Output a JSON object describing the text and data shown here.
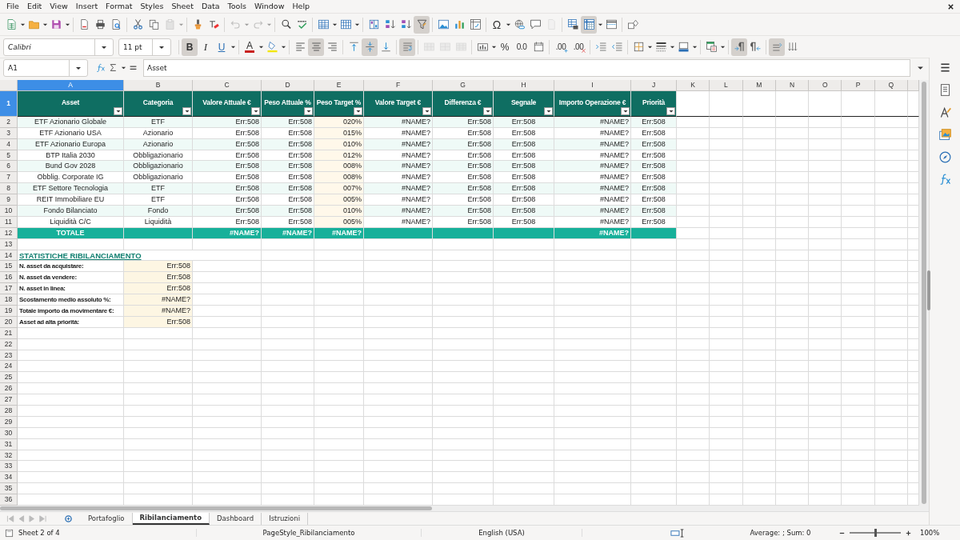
{
  "menu": [
    "File",
    "Edit",
    "View",
    "Insert",
    "Format",
    "Styles",
    "Sheet",
    "Data",
    "Tools",
    "Window",
    "Help"
  ],
  "toolbar_standard": [
    {
      "kind": "new",
      "dropdown": true,
      "pressed": false,
      "disabled": false
    },
    {
      "kind": "open",
      "dropdown": true,
      "pressed": false,
      "disabled": false
    },
    {
      "kind": "save",
      "dropdown": true,
      "pressed": false,
      "disabled": false
    },
    {
      "kind": "separator"
    },
    {
      "kind": "export_pdf",
      "pressed": false,
      "disabled": false
    },
    {
      "kind": "print",
      "pressed": false,
      "disabled": false
    },
    {
      "kind": "print_preview",
      "pressed": false,
      "disabled": false
    },
    {
      "kind": "separator"
    },
    {
      "kind": "cut",
      "pressed": false,
      "disabled": false
    },
    {
      "kind": "copy",
      "pressed": false,
      "disabled": false
    },
    {
      "kind": "paste",
      "dropdown": true,
      "pressed": false,
      "disabled": true
    },
    {
      "kind": "separator"
    },
    {
      "kind": "clone_formatting",
      "pressed": false,
      "disabled": false
    },
    {
      "kind": "clear_formatting",
      "pressed": false,
      "disabled": false
    },
    {
      "kind": "separator"
    },
    {
      "kind": "undo",
      "dropdown": true,
      "pressed": false,
      "disabled": true
    },
    {
      "kind": "redo",
      "dropdown": true,
      "pressed": false,
      "disabled": true
    },
    {
      "kind": "separator"
    },
    {
      "kind": "find_replace",
      "pressed": false,
      "disabled": false
    },
    {
      "kind": "spelling",
      "pressed": false,
      "disabled": false
    },
    {
      "kind": "separator"
    },
    {
      "kind": "rows",
      "dropdown": true,
      "pressed": false,
      "disabled": false
    },
    {
      "kind": "columns",
      "dropdown": true,
      "pressed": false,
      "disabled": false
    },
    {
      "kind": "separator"
    },
    {
      "kind": "sort",
      "pressed": false,
      "disabled": false
    },
    {
      "kind": "sort_ascending",
      "pressed": false,
      "disabled": false
    },
    {
      "kind": "sort_descending",
      "pressed": false,
      "disabled": false
    },
    {
      "kind": "autofilter",
      "pressed": true,
      "disabled": false
    },
    {
      "kind": "separator"
    },
    {
      "kind": "image",
      "pressed": false,
      "disabled": false
    },
    {
      "kind": "chart",
      "pressed": false,
      "disabled": false
    },
    {
      "kind": "pivot_table",
      "pressed": false,
      "disabled": false
    },
    {
      "kind": "separator"
    },
    {
      "kind": "special_character",
      "label": "Ω",
      "dropdown": true,
      "pressed": false,
      "disabled": false
    },
    {
      "kind": "hyperlink",
      "pressed": false,
      "disabled": false
    },
    {
      "kind": "comment",
      "pressed": false,
      "disabled": false
    },
    {
      "kind": "header_footer",
      "pressed": false,
      "disabled": true
    },
    {
      "kind": "separator"
    },
    {
      "kind": "print_area",
      "pressed": false,
      "disabled": false
    },
    {
      "kind": "freeze",
      "dropdown": true,
      "pressed": true,
      "disabled": false
    },
    {
      "kind": "split_window",
      "pressed": false,
      "disabled": false
    },
    {
      "kind": "separator"
    },
    {
      "kind": "shapes",
      "pressed": false,
      "disabled": false
    }
  ],
  "font_name": {
    "value": "Calibri"
  },
  "font_size": {
    "value": "11 pt"
  },
  "toolbar_formatting": [
    {
      "kind": "separator"
    },
    {
      "kind": "bold",
      "label": "B",
      "pressed": true,
      "disabled": false
    },
    {
      "kind": "italic",
      "label": "I",
      "pressed": false,
      "disabled": false
    },
    {
      "kind": "underline",
      "label": "U",
      "dropdown": true,
      "pressed": false,
      "disabled": false
    },
    {
      "kind": "separator"
    },
    {
      "kind": "font_color",
      "label": "A",
      "dropdown": true,
      "pressed": false,
      "disabled": false
    },
    {
      "kind": "highlight",
      "dropdown": true,
      "pressed": false,
      "disabled": false
    },
    {
      "kind": "separator"
    },
    {
      "kind": "align_left",
      "pressed": false,
      "disabled": false
    },
    {
      "kind": "align_center",
      "pressed": true,
      "disabled": false
    },
    {
      "kind": "align_right",
      "pressed": false,
      "disabled": false
    },
    {
      "kind": "separator"
    },
    {
      "kind": "align_top",
      "pressed": false,
      "disabled": false
    },
    {
      "kind": "align_middle",
      "pressed": true,
      "disabled": false
    },
    {
      "kind": "align_bottom",
      "pressed": false,
      "disabled": false
    },
    {
      "kind": "separator"
    },
    {
      "kind": "wrap_text",
      "pressed": true,
      "disabled": false
    },
    {
      "kind": "separator"
    },
    {
      "kind": "merge_center",
      "pressed": false,
      "disabled": true
    },
    {
      "kind": "merge_cells",
      "pressed": false,
      "disabled": true
    },
    {
      "kind": "unmerge_cells",
      "pressed": false,
      "disabled": true
    },
    {
      "kind": "separator"
    },
    {
      "kind": "number_format",
      "dropdown": true,
      "pressed": false,
      "disabled": false
    },
    {
      "kind": "percent",
      "label": "%",
      "pressed": false,
      "disabled": false
    },
    {
      "kind": "standard_format",
      "label": "0.0",
      "pressed": false,
      "disabled": false
    },
    {
      "kind": "date",
      "pressed": false,
      "disabled": false
    },
    {
      "kind": "separator"
    },
    {
      "kind": "add_decimal",
      "label": ".00",
      "pressed": false,
      "disabled": false
    },
    {
      "kind": "delete_decimal",
      "label": ".00",
      "pressed": false,
      "disabled": false
    },
    {
      "kind": "separator"
    },
    {
      "kind": "indent",
      "pressed": false,
      "disabled": false
    },
    {
      "kind": "outdent",
      "pressed": false,
      "disabled": false
    },
    {
      "kind": "separator"
    },
    {
      "kind": "borders",
      "dropdown": true,
      "pressed": false,
      "disabled": false
    },
    {
      "kind": "border_style",
      "dropdown": true,
      "pressed": false,
      "disabled": false
    },
    {
      "kind": "border_color",
      "dropdown": true,
      "pressed": false,
      "disabled": false
    },
    {
      "kind": "separator"
    },
    {
      "kind": "conditional",
      "dropdown": true,
      "pressed": false,
      "disabled": false
    },
    {
      "kind": "separator"
    },
    {
      "kind": "left_to_right",
      "pressed": true,
      "disabled": false
    },
    {
      "kind": "right_to_left",
      "pressed": false,
      "disabled": false
    },
    {
      "kind": "separator"
    },
    {
      "kind": "text_horizontal",
      "pressed": true,
      "disabled": false
    },
    {
      "kind": "text_vertical",
      "pressed": false,
      "disabled": false
    }
  ],
  "name_box": {
    "value": "A1"
  },
  "formula": {
    "value": "Asset"
  },
  "columns": [
    {
      "letter": "A",
      "selected": true
    },
    {
      "letter": "B",
      "selected": false
    },
    {
      "letter": "C",
      "selected": false
    },
    {
      "letter": "D",
      "selected": false
    },
    {
      "letter": "E",
      "selected": false
    },
    {
      "letter": "F",
      "selected": false
    },
    {
      "letter": "G",
      "selected": false
    },
    {
      "letter": "H",
      "selected": false
    },
    {
      "letter": "I",
      "selected": false
    },
    {
      "letter": "J",
      "selected": false
    },
    {
      "letter": "K",
      "selected": false
    },
    {
      "letter": "L",
      "selected": false
    },
    {
      "letter": "M",
      "selected": false
    },
    {
      "letter": "N",
      "selected": false
    },
    {
      "letter": "O",
      "selected": false
    },
    {
      "letter": "P",
      "selected": false
    },
    {
      "letter": "Q",
      "selected": false
    }
  ],
  "row_numbers": [
    {
      "label": "1",
      "selected": true
    },
    {
      "label": "2",
      "selected": false
    },
    {
      "label": "3",
      "selected": false
    },
    {
      "label": "4",
      "selected": false
    },
    {
      "label": "5",
      "selected": false
    },
    {
      "label": "6",
      "selected": false
    },
    {
      "label": "7",
      "selected": false
    },
    {
      "label": "8",
      "selected": false
    },
    {
      "label": "9",
      "selected": false
    },
    {
      "label": "10",
      "selected": false
    },
    {
      "label": "11",
      "selected": false
    },
    {
      "label": "12",
      "selected": false
    },
    {
      "label": "13",
      "selected": false
    },
    {
      "label": "14",
      "selected": false
    },
    {
      "label": "15",
      "selected": false
    },
    {
      "label": "16",
      "selected": false
    },
    {
      "label": "17",
      "selected": false
    },
    {
      "label": "18",
      "selected": false
    },
    {
      "label": "19",
      "selected": false
    },
    {
      "label": "20",
      "selected": false
    },
    {
      "label": "21",
      "selected": false
    },
    {
      "label": "22",
      "selected": false
    },
    {
      "label": "23",
      "selected": false
    },
    {
      "label": "24",
      "selected": false
    },
    {
      "label": "25",
      "selected": false
    },
    {
      "label": "26",
      "selected": false
    },
    {
      "label": "27",
      "selected": false
    },
    {
      "label": "28",
      "selected": false
    },
    {
      "label": "29",
      "selected": false
    },
    {
      "label": "30",
      "selected": false
    },
    {
      "label": "31",
      "selected": false
    },
    {
      "label": "32",
      "selected": false
    },
    {
      "label": "33",
      "selected": false
    },
    {
      "label": "34",
      "selected": false
    },
    {
      "label": "35",
      "selected": false
    },
    {
      "label": "36",
      "selected": false
    }
  ],
  "table": {
    "headers": [
      "Asset",
      "Categoria",
      "Valore Attuale €",
      "Peso Attuale %",
      "Peso Target %",
      "Valore Target €",
      "Differenza €",
      "Segnale",
      "Importo Operazione €",
      "Priorità"
    ],
    "rows": [
      [
        "ETF Azionario Globale",
        "ETF",
        "Err:508",
        "Err:508",
        "020%",
        "#NAME?",
        "Err:508",
        "Err:508",
        "#NAME?",
        "Err:508"
      ],
      [
        "ETF Azionario USA",
        "Azionario",
        "Err:508",
        "Err:508",
        "015%",
        "#NAME?",
        "Err:508",
        "Err:508",
        "#NAME?",
        "Err:508"
      ],
      [
        "ETF Azionario Europa",
        "Azionario",
        "Err:508",
        "Err:508",
        "010%",
        "#NAME?",
        "Err:508",
        "Err:508",
        "#NAME?",
        "Err:508"
      ],
      [
        "BTP Italia 2030",
        "Obbligazionario",
        "Err:508",
        "Err:508",
        "012%",
        "#NAME?",
        "Err:508",
        "Err:508",
        "#NAME?",
        "Err:508"
      ],
      [
        "Bund Gov 2028",
        "Obbligazionario",
        "Err:508",
        "Err:508",
        "008%",
        "#NAME?",
        "Err:508",
        "Err:508",
        "#NAME?",
        "Err:508"
      ],
      [
        "Obblig. Corporate IG",
        "Obbligazionario",
        "Err:508",
        "Err:508",
        "008%",
        "#NAME?",
        "Err:508",
        "Err:508",
        "#NAME?",
        "Err:508"
      ],
      [
        "ETF Settore Tecnologia",
        "ETF",
        "Err:508",
        "Err:508",
        "007%",
        "#NAME?",
        "Err:508",
        "Err:508",
        "#NAME?",
        "Err:508"
      ],
      [
        "REIT Immobiliare EU",
        "ETF",
        "Err:508",
        "Err:508",
        "005%",
        "#NAME?",
        "Err:508",
        "Err:508",
        "#NAME?",
        "Err:508"
      ],
      [
        "Fondo Bilanciato",
        "Fondo",
        "Err:508",
        "Err:508",
        "010%",
        "#NAME?",
        "Err:508",
        "Err:508",
        "#NAME?",
        "Err:508"
      ],
      [
        "Liquidità C/C",
        "Liquidità",
        "Err:508",
        "Err:508",
        "005%",
        "#NAME?",
        "Err:508",
        "Err:508",
        "#NAME?",
        "Err:508"
      ]
    ],
    "total": [
      {
        "kind": "text",
        "text": "TOTALE"
      },
      {
        "kind": "blank"
      },
      {
        "kind": "text",
        "text": "#NAME?"
      },
      {
        "kind": "text",
        "text": "#NAME?"
      },
      {
        "kind": "text",
        "text": "#NAME?"
      },
      {
        "kind": "blank"
      },
      {
        "kind": "blank"
      },
      {
        "kind": "blank"
      },
      {
        "kind": "text",
        "text": "#NAME?"
      },
      {
        "kind": "blank"
      }
    ]
  },
  "stats": {
    "title": "STATISTICHE RIBILANCIAMENTO",
    "items": [
      {
        "label": "N. asset da acquistare:",
        "value": "Err:508"
      },
      {
        "label": "N. asset da vendere:",
        "value": "Err:508"
      },
      {
        "label": "N. asset in linea:",
        "value": "Err:508"
      },
      {
        "label": "Scostamento medio assoluto %:",
        "value": "#NAME?"
      },
      {
        "label": "Totale importo da movimentare €:",
        "value": "#NAME?"
      },
      {
        "label": "Asset ad alta priorità:",
        "value": "Err:508"
      }
    ]
  },
  "sheet_tabs": [
    {
      "label": "Portafoglio",
      "selected": false
    },
    {
      "label": "Ribilanciamento",
      "selected": true
    },
    {
      "label": "Dashboard",
      "selected": false
    },
    {
      "label": "Istruzioni",
      "selected": false
    }
  ],
  "status_bar": {
    "sheet": "Sheet 2 of 4",
    "page_style": "PageStyle_Ribilanciamento",
    "language": "English (USA)",
    "summary": "Average: ; Sum: 0",
    "zoom": {
      "level": 0.5,
      "value": "100%"
    }
  }
}
